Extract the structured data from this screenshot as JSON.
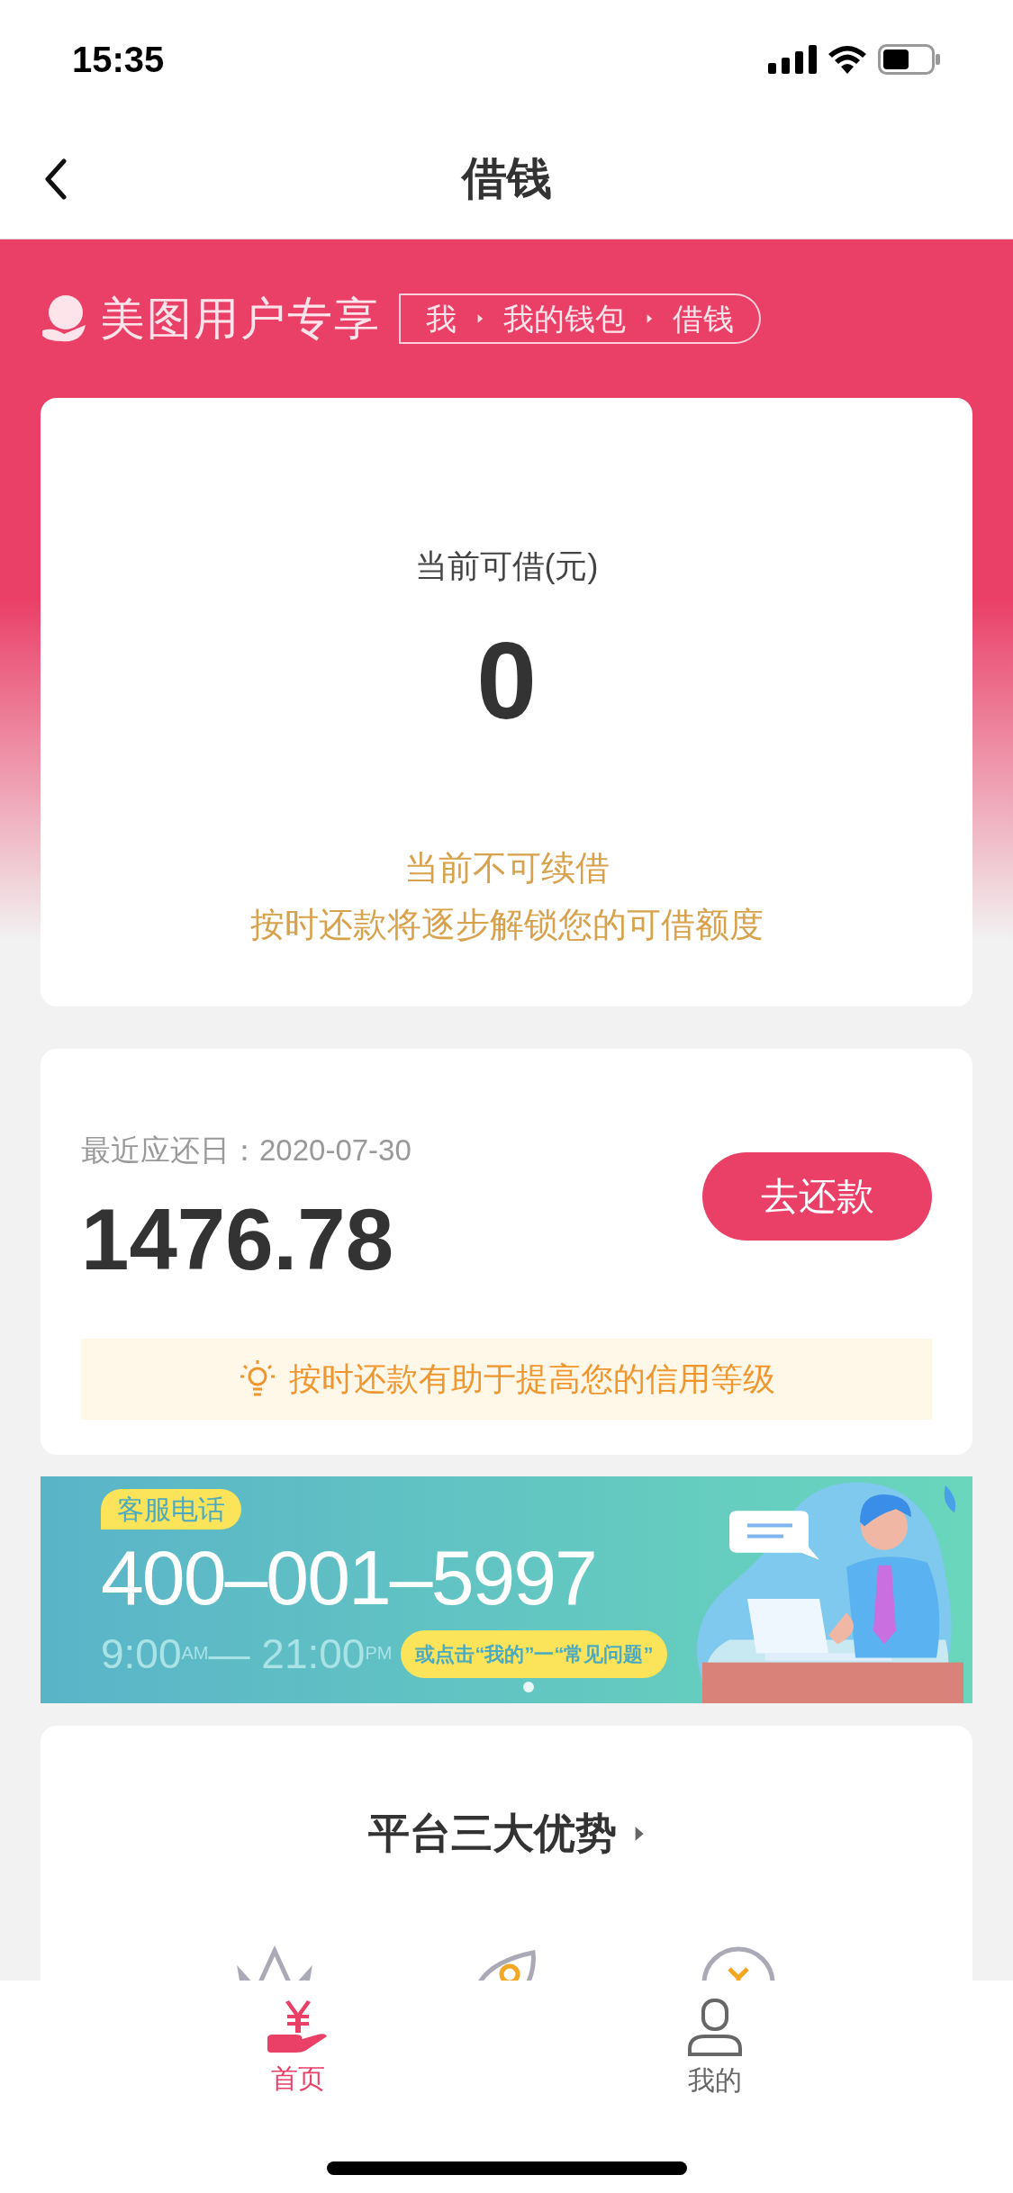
{
  "status_bar": {
    "time": "15:35"
  },
  "nav": {
    "title": "借钱"
  },
  "brand": {
    "title": "美图用户专享",
    "breadcrumb": [
      "我",
      "我的钱包",
      "借钱"
    ]
  },
  "credit": {
    "label": "当前可借(元)",
    "amount": "0",
    "notice": "当前不可续借",
    "hint": "按时还款将逐步解锁您的可借额度"
  },
  "repay": {
    "due_label": "最近应还日：",
    "due_date": "2020-07-30",
    "amount": "1476.78",
    "button": "去还款",
    "tip": "按时还款有助于提高您的信用等级"
  },
  "banner": {
    "badge": "客服电话",
    "phone": "400–001–5997",
    "hours": "9:00$^{AM}$— 21:00$^{PM}$",
    "faq": "或点击“我的”一“常见问题”"
  },
  "advantages": {
    "title": "平台三大优势"
  },
  "tab_bar": [
    {
      "label": "首页",
      "kind": "home",
      "selected": true
    },
    {
      "label": "我的",
      "kind": "profile",
      "selected": false
    }
  ]
}
